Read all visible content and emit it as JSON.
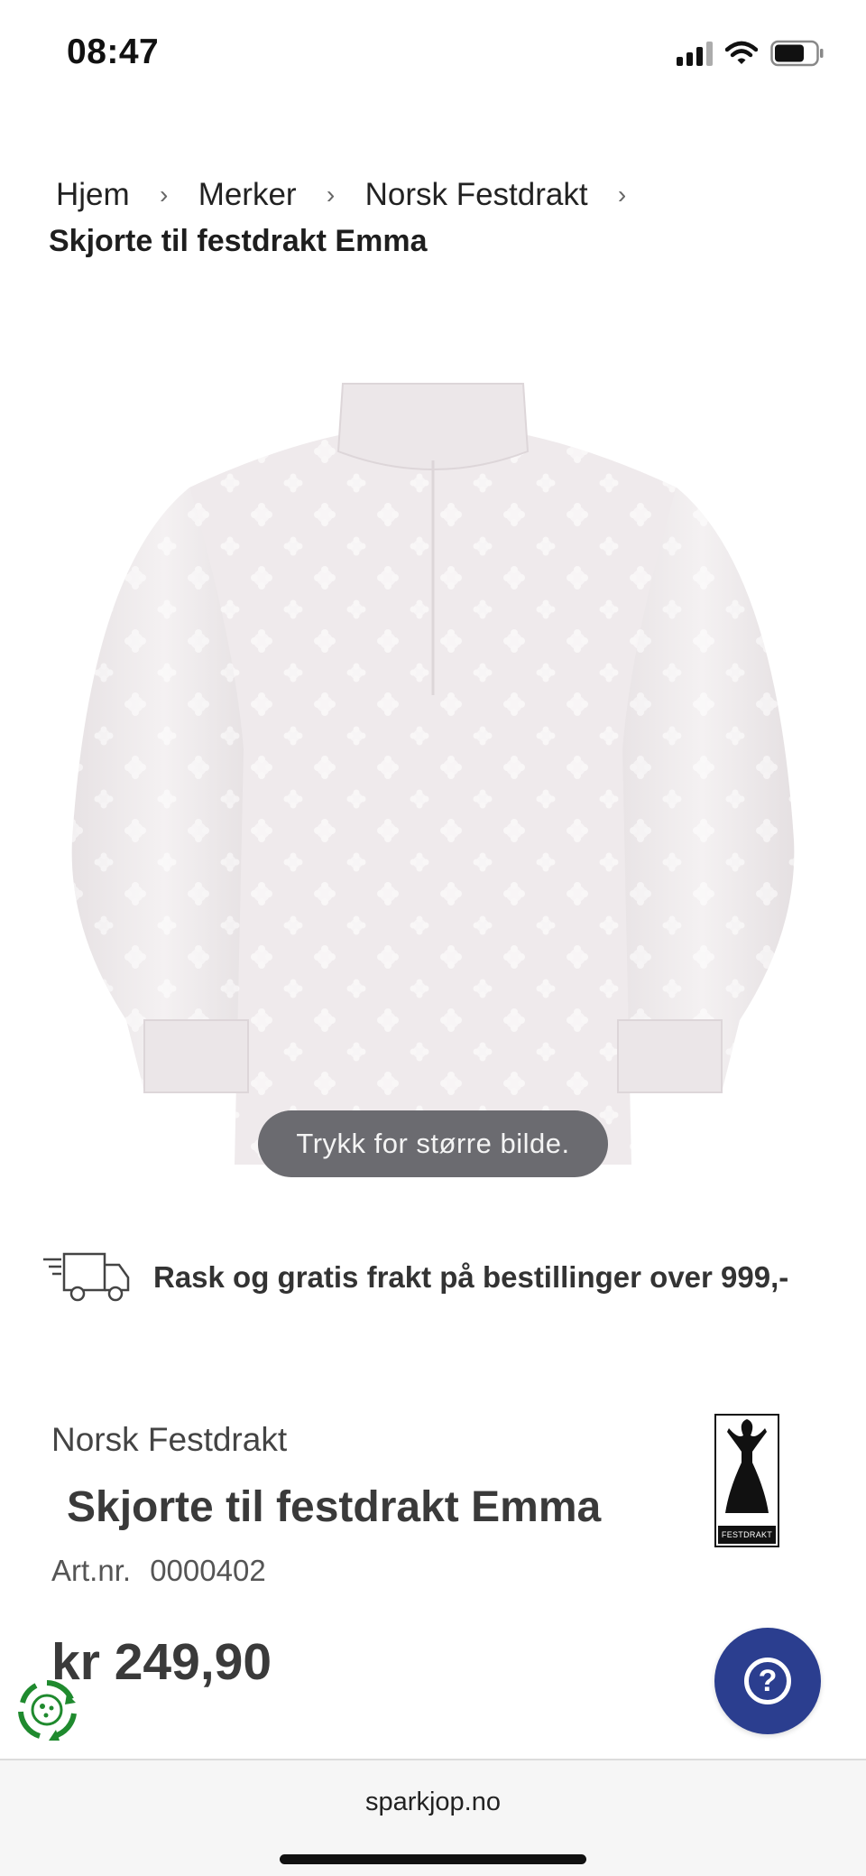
{
  "status_bar": {
    "time": "08:47",
    "icons": [
      "signal-icon",
      "wifi-icon",
      "battery-icon"
    ]
  },
  "breadcrumb": {
    "items": [
      "Hjem",
      "Merker",
      "Norsk Festdrakt"
    ],
    "current": "Skjorte til festdrakt Emma"
  },
  "image": {
    "zoom_hint": "Trykk for større bilde."
  },
  "shipping": {
    "icon": "truck-icon",
    "text": "Rask og gratis frakt på bestillinger over 999,-"
  },
  "product": {
    "brand": "Norsk Festdrakt",
    "title": "Skjorte til festdrakt Emma",
    "art_label": "Art.nr.",
    "art_number": "0000402",
    "price": "kr 249,90",
    "logo_text": "FESTDRAKT"
  },
  "help": {
    "icon": "question-mark-icon"
  },
  "recycle": {
    "icon": "recycle-icon"
  },
  "browser": {
    "domain": "sparkjop.no"
  },
  "colors": {
    "help_button": "#2b3e8f",
    "recycle_green": "#1f8a2e",
    "zoom_hint_bg": "#6b6b70"
  }
}
